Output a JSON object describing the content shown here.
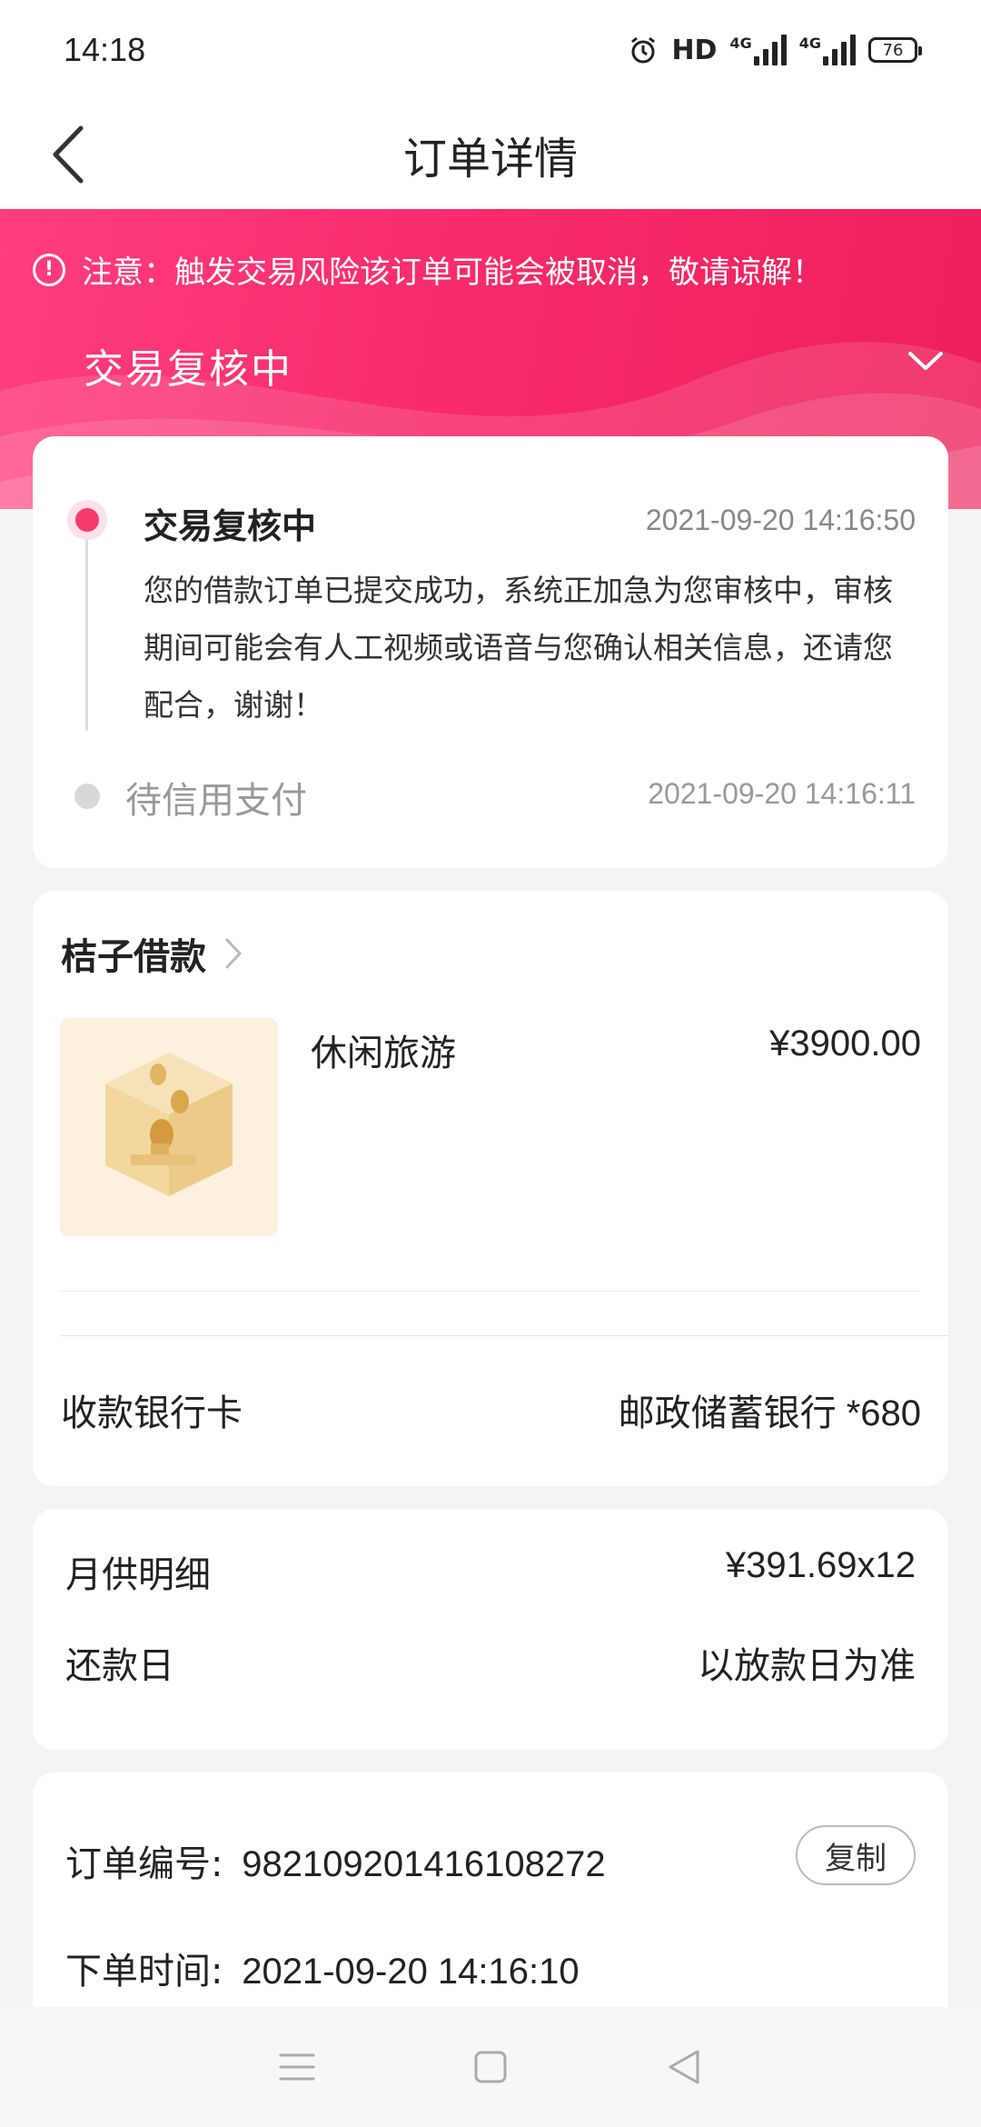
{
  "status_bar": {
    "time": "14:18",
    "hd_label": "HD",
    "network1": "4G",
    "network2": "4G",
    "battery": "76",
    "icons": [
      "alarm-icon",
      "signal-icon",
      "signal-icon",
      "battery-icon"
    ]
  },
  "header": {
    "title": "订单详情",
    "back_icon": "chevron-left-icon"
  },
  "hero": {
    "notice": "注意：触发交易风险该订单可能会被取消，敬请谅解！",
    "status": "交易复核中",
    "accent_color": "#f72a6a"
  },
  "timeline": [
    {
      "title": "交易复核中",
      "time": "2021-09-20 14:16:50",
      "desc": "您的借款订单已提交成功，系统正加急为您审核中，审核期间可能会有人工视频或语音与您确认相关信息，还请您配合，谢谢！",
      "active": true
    },
    {
      "title": "待信用支付",
      "time": "2021-09-20 14:16:11",
      "active": false
    }
  ],
  "product": {
    "merchant": "桔子借款",
    "name": "休闲旅游",
    "price": "¥3900.00",
    "bank_label": "收款银行卡",
    "bank_value": "邮政储蓄银行 *680"
  },
  "repayment": {
    "monthly_label": "月供明细",
    "monthly_value": "¥391.69x12",
    "day_label": "还款日",
    "day_value": "以放款日为准"
  },
  "order": {
    "number_label": "订单编号:",
    "number": "982109201416108272",
    "copy_label": "复制",
    "time_label": "下单时间:",
    "time": "2021-09-20 14:16:10"
  },
  "nav": [
    "menu-icon",
    "home-icon",
    "back-triangle-icon"
  ]
}
